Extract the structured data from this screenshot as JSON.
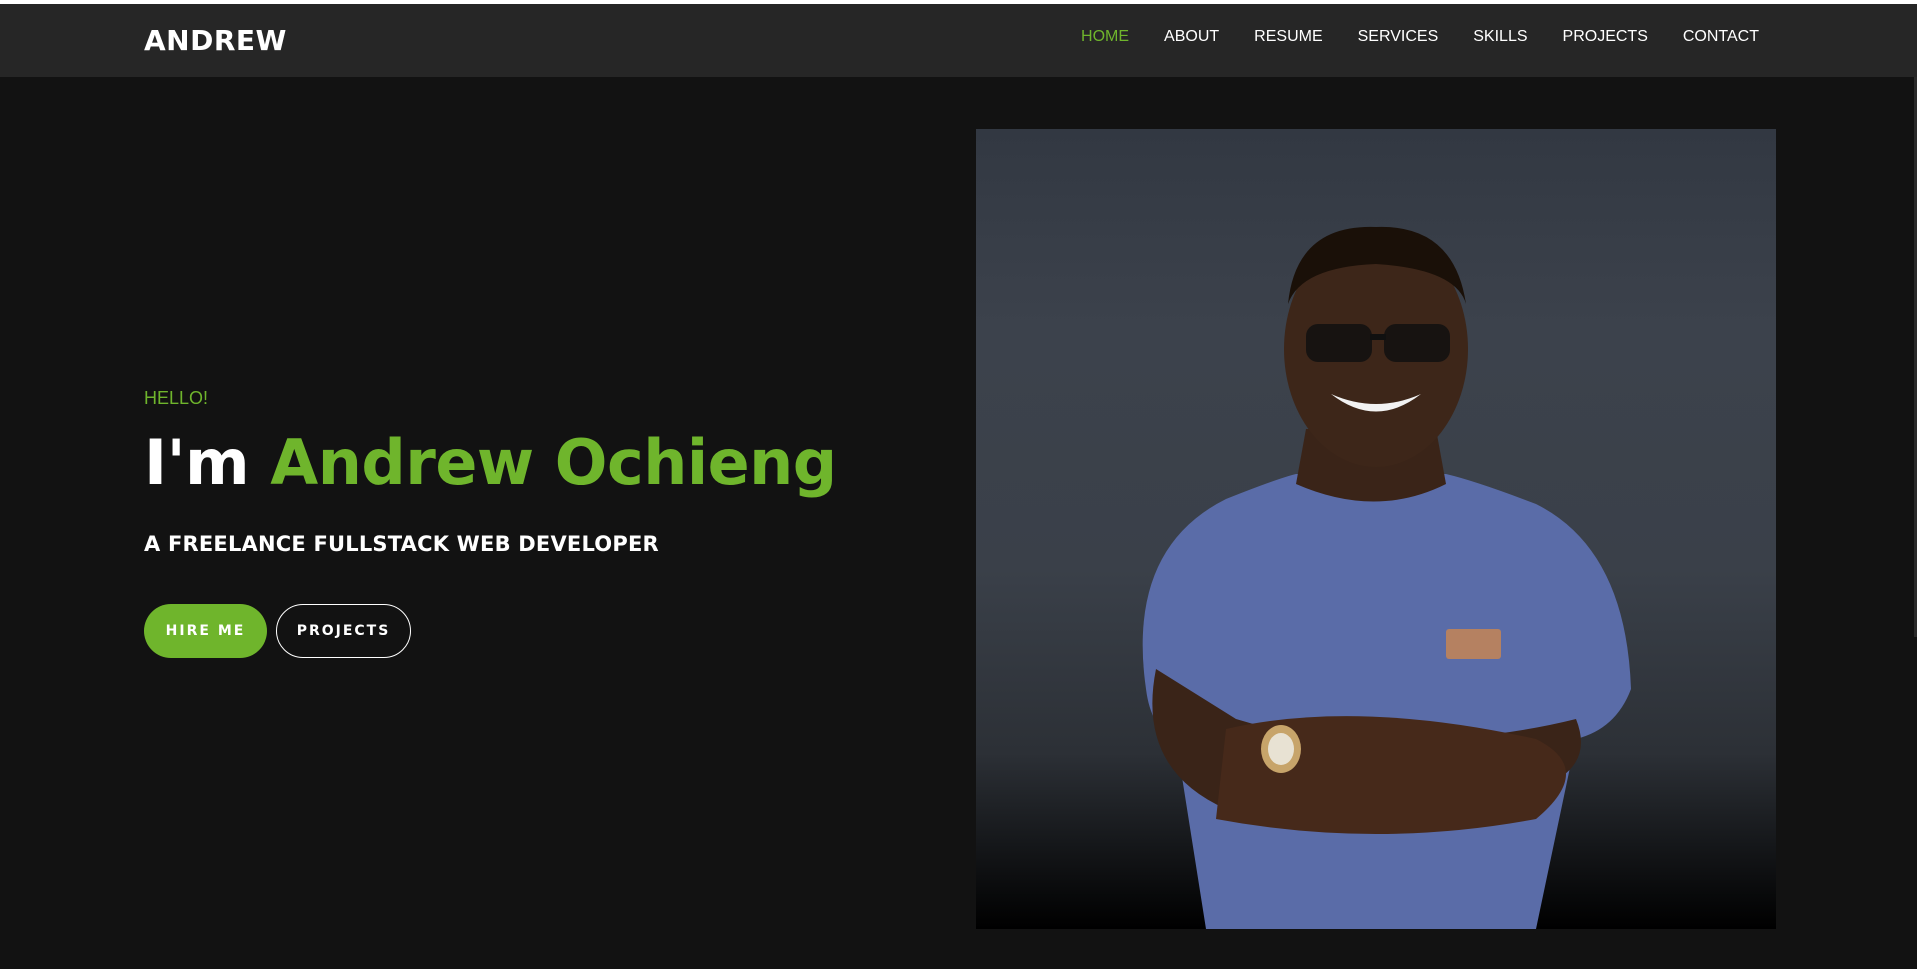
{
  "brand": "ANDREW",
  "nav": {
    "items": [
      {
        "label": "HOME",
        "active": true
      },
      {
        "label": "ABOUT"
      },
      {
        "label": "RESUME"
      },
      {
        "label": "SERVICES"
      },
      {
        "label": "SKILLS"
      },
      {
        "label": "PROJECTS"
      },
      {
        "label": "CONTACT"
      }
    ]
  },
  "hero": {
    "greeting": "HELLO!",
    "im": "I'm",
    "name": "Andrew Ochieng",
    "subtitle": "A FREELANCE FULLSTACK WEB DEVELOPER",
    "hire_label": "HIRE ME",
    "projects_label": "PROJECTS"
  },
  "colors": {
    "accent": "#6fb52c",
    "background": "#121212",
    "navbar": "#262626",
    "text": "#ffffff"
  },
  "icons": {
    "portrait": "person-photo"
  }
}
